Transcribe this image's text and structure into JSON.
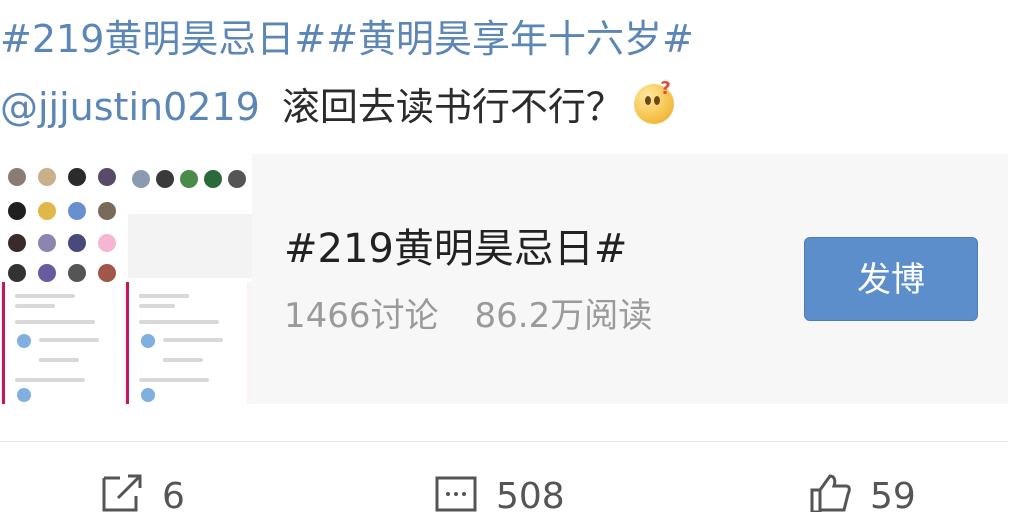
{
  "post": {
    "hashtags": "#219黄明昊忌日##黄明昊享年十六岁#",
    "mention": "@jjjustin0219",
    "message": "滚回去读书行不行？",
    "emoji": "thinking-face-emoji"
  },
  "topic_card": {
    "title": "#219黄明昊忌日#",
    "discussions": "1466讨论",
    "reads": "86.2万阅读",
    "post_button": "发博"
  },
  "actions": {
    "repost_count": "6",
    "comment_count": "508",
    "like_count": "59"
  }
}
